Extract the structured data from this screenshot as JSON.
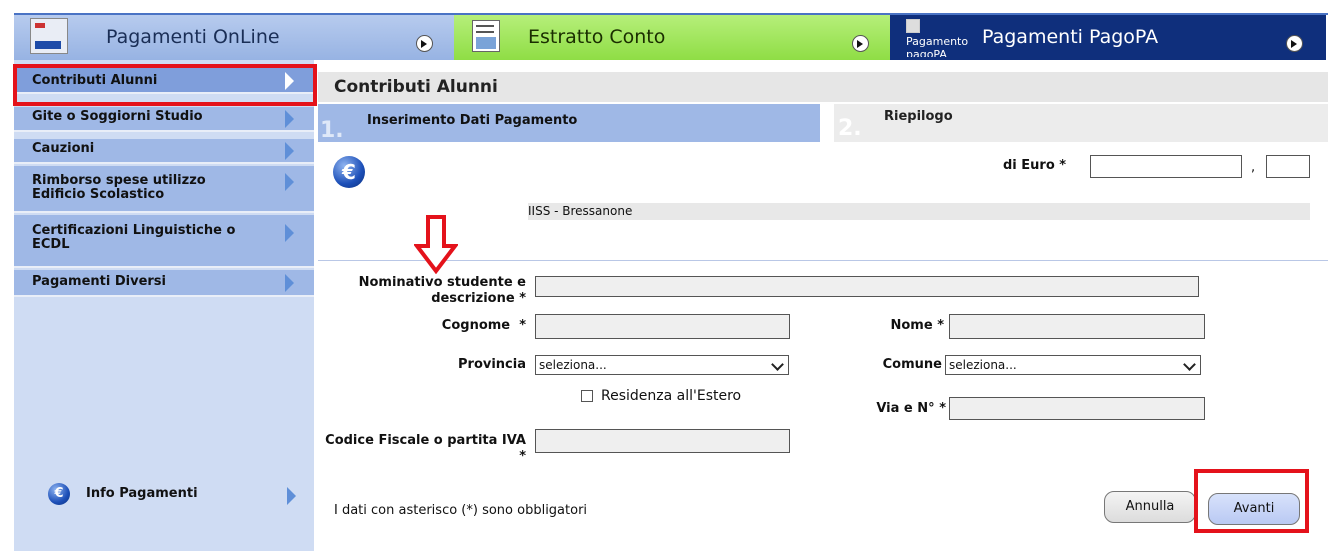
{
  "tabs": {
    "pagamenti_online": "Pagamenti OnLine",
    "estratto_conto": "Estratto Conto",
    "pagopa": "Pagamenti PagoPA",
    "pagopa_img_alt": "Pagamento pagoPA"
  },
  "sidebar": {
    "items": [
      {
        "label": "Contributi Alunni"
      },
      {
        "label": "Gite o Soggiorni Studio"
      },
      {
        "label": "Cauzioni"
      },
      {
        "label": "Rimborso spese utilizzo Edificio Scolastico"
      },
      {
        "label": "Certificazioni Linguistiche o ECDL"
      },
      {
        "label": "Pagamenti Diversi"
      }
    ],
    "info": "Info Pagamenti"
  },
  "main": {
    "title": "Contributi Alunni",
    "steps": [
      {
        "num": "1.",
        "label": "Inserimento Dati Pagamento"
      },
      {
        "num": "2.",
        "label": "Riepilogo"
      }
    ],
    "amount_label": "di Euro",
    "decimal_sep": ",",
    "school": "IISS - Bressanone"
  },
  "form": {
    "nominativo_label": "Nominativo studente e descrizione",
    "cognome_label": "Cognome",
    "nome_label": "Nome",
    "provincia_label": "Provincia",
    "provincia_value": "seleziona...",
    "comune_label": "Comune",
    "comune_value": "seleziona...",
    "residenza_label": "Residenza all'Estero",
    "via_label": "Via e N°",
    "codice_label": "Codice Fiscale o partita IVA",
    "required_mark": "*",
    "note": "I dati con asterisco (*) sono obbligatori",
    "annulla": "Annulla",
    "avanti": "Avanti"
  },
  "colors": {
    "accent_blue": "#9fb8e6",
    "highlight_red": "#e4121b",
    "pagopa_navy": "#0f2f7c",
    "green_tab": "#8fdd45"
  }
}
